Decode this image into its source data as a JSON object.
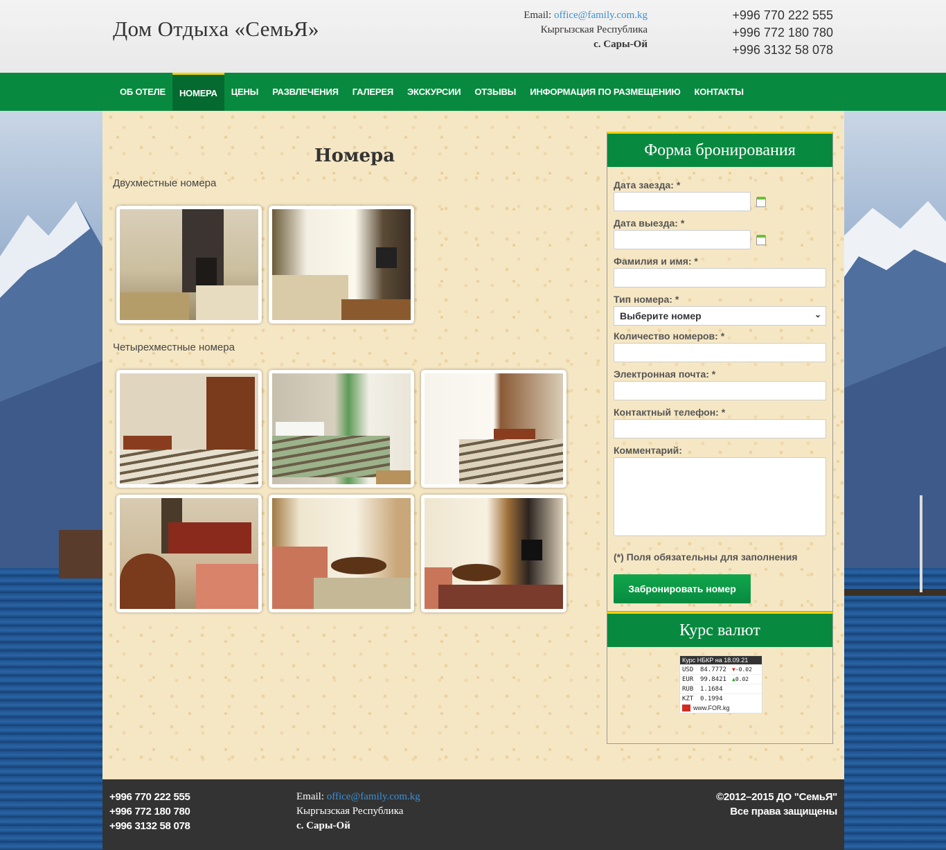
{
  "header": {
    "site_title": "Дом Отдыха «СемьЯ»",
    "email_label": "Email:",
    "email": "office@family.com.kg",
    "country": "Кыргызская Республика",
    "village": "с. Сары-Ой",
    "phones": [
      "+996 770 222 555",
      "+996 772 180 780",
      "+996 3132 58 078"
    ]
  },
  "nav": {
    "items": [
      "Об отеле",
      "Номера",
      "Цены",
      "Развлечения",
      "Галерея",
      "Экскурсии",
      "Отзывы",
      "Информация по размещению",
      "Контакты"
    ],
    "active": "Номера"
  },
  "content": {
    "title": "Номера",
    "double_label": "Двухместные номера",
    "quad_label": "Четырехместные номера"
  },
  "booking": {
    "title": "Форма бронирования",
    "check_in_label": "Дата заезда: *",
    "check_out_label": "Дата выезда: *",
    "name_label": "Фамилия и имя: *",
    "room_type_label": "Тип номера: *",
    "room_type_value": "Выберите номер",
    "rooms_count_label": "Количество номеров: *",
    "email_label": "Электронная почта: *",
    "phone_label": "Контактный телефон: *",
    "comment_label": "Комментарий:",
    "required_note": "(*) Поля обязательны для заполнения",
    "submit_label": "Забронировать номер"
  },
  "currency": {
    "title": "Курс валют",
    "widget_header": "Курс НБКР на 18.09.21",
    "rates": [
      {
        "code": "USD",
        "value": "84.7772",
        "change": "-0.02",
        "dir": "down"
      },
      {
        "code": "EUR",
        "value": "99.8421",
        "change": "0.02",
        "dir": "up"
      },
      {
        "code": "RUB",
        "value": "1.1684",
        "change": "",
        "dir": ""
      },
      {
        "code": "KZT",
        "value": "0.1994",
        "change": "",
        "dir": ""
      }
    ],
    "widget_footer": "www.FOR.kg"
  },
  "footer": {
    "phones": [
      "+996 770 222 555",
      "+996 772 180 780",
      "+996 3132 58 078"
    ],
    "email_label": "Email:",
    "email": "office@family.com.kg",
    "country": "Кыргызская Республика",
    "village": "с. Сары-Ой",
    "copyright": "©2012–2015 ДО \"СемьЯ\"",
    "rights": "Все права защищены"
  },
  "colors": {
    "nav_green": "#078a3f",
    "accent_yellow": "#f2d100",
    "footer_bg": "#333333",
    "link_blue": "#3a8fd6"
  }
}
